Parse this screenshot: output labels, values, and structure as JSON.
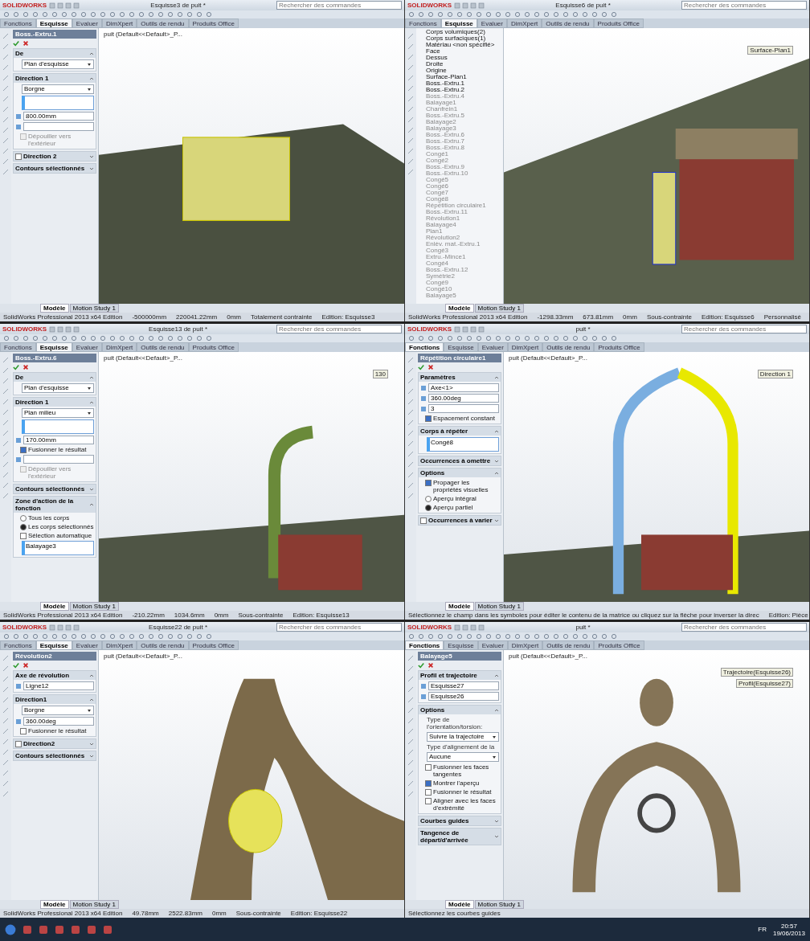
{
  "panels": [
    {
      "title": "Esquisse3 de puit *",
      "search": {
        "placeholder": "Rechercher des commandes"
      },
      "logo": "SOLIDWORKS",
      "tabs": [
        {
          "label": "Fonctions",
          "selected": false
        },
        {
          "label": "Esquisse",
          "selected": true
        },
        {
          "label": "Evaluer",
          "selected": false
        },
        {
          "label": "DimXpert",
          "selected": false
        },
        {
          "label": "Outils de rendu",
          "selected": false
        },
        {
          "label": "Produits Office",
          "selected": false
        }
      ],
      "left": {
        "kind": "property",
        "feature": "Boss.-Extru.1",
        "sections": [
          {
            "title": "De",
            "expanded": true,
            "items": [
              {
                "kind": "dropdown",
                "value": "Plan d'esquisse"
              }
            ]
          },
          {
            "title": "Direction 1",
            "expanded": true,
            "items": [
              {
                "kind": "dropdown",
                "value": "Borgne"
              },
              {
                "kind": "list"
              },
              {
                "kind": "field",
                "value": "800.00mm"
              },
              {
                "kind": "field"
              },
              {
                "kind": "checkbox",
                "label": "Dépouiller vers l'extérieur",
                "checked": false,
                "disabled": true
              }
            ]
          },
          {
            "title": "Direction 2",
            "expanded": false,
            "checked": false
          },
          {
            "title": "Contours sélectionnés",
            "expanded": false
          }
        ]
      },
      "viewport": {
        "kind": "extrude",
        "tree_path": "puit (Default<<Default>_P..."
      },
      "tabs_bottom": [
        {
          "label": "Modèle",
          "selected": true
        },
        {
          "label": "Motion Study 1",
          "selected": false
        }
      ],
      "status": [
        "SolidWorks Professional 2013 x64 Edition",
        "-500000mm",
        "220041.22mm",
        "0mm",
        "Totalement contrainte",
        "Edition: Esquisse3"
      ]
    },
    {
      "title": "Esquisse6 de puit *",
      "search": {
        "placeholder": "Rechercher des commandes"
      },
      "logo": "SOLIDWORKS",
      "tabs": [
        {
          "label": "Fonctions",
          "selected": false
        },
        {
          "label": "Esquisse",
          "selected": true
        },
        {
          "label": "Evaluer",
          "selected": false
        },
        {
          "label": "DimXpert",
          "selected": false
        },
        {
          "label": "Outils de rendu",
          "selected": false
        },
        {
          "label": "Produits Office",
          "selected": false
        }
      ],
      "left": {
        "kind": "tree",
        "items": [
          {
            "label": "Corps volumiques(2)",
            "disabled": false
          },
          {
            "label": "Corps surfaciques(1)",
            "disabled": false
          },
          {
            "label": "Matériau <non spécifié>",
            "disabled": false
          },
          {
            "label": "Face",
            "disabled": false
          },
          {
            "label": "Dessus",
            "disabled": false
          },
          {
            "label": "Droite",
            "disabled": false
          },
          {
            "label": "Origine",
            "disabled": false
          },
          {
            "label": "Surface-Plan1",
            "disabled": false
          },
          {
            "label": "Boss.-Extru.1",
            "disabled": false
          },
          {
            "label": "Boss.-Extru.2",
            "disabled": false
          },
          {
            "label": "Boss.-Extru.4",
            "disabled": true
          },
          {
            "label": "Balayage1",
            "disabled": true
          },
          {
            "label": "Chanfrein1",
            "disabled": true
          },
          {
            "label": "Boss.-Extru.5",
            "disabled": true
          },
          {
            "label": "Balayage2",
            "disabled": true
          },
          {
            "label": "Balayage3",
            "disabled": true
          },
          {
            "label": "Boss.-Extru.6",
            "disabled": true
          },
          {
            "label": "Boss.-Extru.7",
            "disabled": true
          },
          {
            "label": "Boss.-Extru.8",
            "disabled": true
          },
          {
            "label": "Congé1",
            "disabled": true
          },
          {
            "label": "Congé2",
            "disabled": true
          },
          {
            "label": "Boss.-Extru.9",
            "disabled": true
          },
          {
            "label": "Boss.-Extru.10",
            "disabled": true
          },
          {
            "label": "Congé5",
            "disabled": true
          },
          {
            "label": "Congé6",
            "disabled": true
          },
          {
            "label": "Congé7",
            "disabled": true
          },
          {
            "label": "Congé8",
            "disabled": true
          },
          {
            "label": "Répétition circulaire1",
            "disabled": true
          },
          {
            "label": "Boss.-Extru.11",
            "disabled": true
          },
          {
            "label": "Révolution1",
            "disabled": true
          },
          {
            "label": "Balayage4",
            "disabled": true
          },
          {
            "label": "Plan1",
            "disabled": true
          },
          {
            "label": "Révolution2",
            "disabled": true
          },
          {
            "label": "Enlèv. mat.-Extru.1",
            "disabled": true
          },
          {
            "label": "Congé3",
            "disabled": true
          },
          {
            "label": "Extru.-Mince1",
            "disabled": true
          },
          {
            "label": "Congé4",
            "disabled": true
          },
          {
            "label": "Boss.-Extru.12",
            "disabled": true
          },
          {
            "label": "Symétrie2",
            "disabled": true
          },
          {
            "label": "Congé9",
            "disabled": true
          },
          {
            "label": "Congé10",
            "disabled": true
          },
          {
            "label": "Balayage5",
            "disabled": true
          }
        ]
      },
      "viewport": {
        "kind": "well",
        "labels": [
          "Surface-Plan1"
        ]
      },
      "tabs_bottom": [
        {
          "label": "Modèle",
          "selected": true
        },
        {
          "label": "Motion Study 1",
          "selected": false
        }
      ],
      "status": [
        "SolidWorks Professional 2013 x64 Edition",
        "-1298.33mm",
        "673.81mm",
        "0mm",
        "Sous-contrainte",
        "Edition: Esquisse6",
        "Personnalisé"
      ]
    },
    {
      "title": "Esquisse13 de puit *",
      "search": {
        "placeholder": "Rechercher des commandes"
      },
      "logo": "SOLIDWORKS",
      "tabs": [
        {
          "label": "Fonctions",
          "selected": false
        },
        {
          "label": "Esquisse",
          "selected": true
        },
        {
          "label": "Evaluer",
          "selected": false
        },
        {
          "label": "DimXpert",
          "selected": false
        },
        {
          "label": "Outils de rendu",
          "selected": false
        },
        {
          "label": "Produits Office",
          "selected": false
        }
      ],
      "left": {
        "kind": "property",
        "feature": "Boss.-Extru.6",
        "sections": [
          {
            "title": "De",
            "expanded": true,
            "items": [
              {
                "kind": "dropdown",
                "value": "Plan d'esquisse"
              }
            ]
          },
          {
            "title": "Direction 1",
            "expanded": true,
            "items": [
              {
                "kind": "dropdown",
                "value": "Plan milieu"
              },
              {
                "kind": "list"
              },
              {
                "kind": "field",
                "value": "170.00mm"
              },
              {
                "kind": "checkbox",
                "label": "Fusionner le résultat",
                "checked": true,
                "disabled": false
              },
              {
                "kind": "field"
              },
              {
                "kind": "checkbox",
                "label": "Dépouiller vers l'extérieur",
                "checked": false,
                "disabled": true
              }
            ]
          },
          {
            "title": "Contours sélectionnés",
            "expanded": false
          },
          {
            "title": "Zone d'action de la fonction",
            "expanded": true,
            "items": [
              {
                "kind": "radio",
                "label": "Tous les corps",
                "selected": false
              },
              {
                "kind": "radio",
                "label": "Les corps sélectionnés",
                "selected": true
              },
              {
                "kind": "checkbox",
                "label": "Sélection automatique",
                "checked": false,
                "disabled": false
              },
              {
                "kind": "list",
                "value": "Balayage3"
              }
            ]
          }
        ]
      },
      "viewport": {
        "kind": "pipe",
        "tree_path": "puit (Default<<Default>_P...",
        "labels": [
          "130"
        ]
      },
      "tabs_bottom": [
        {
          "label": "Modèle",
          "selected": true
        },
        {
          "label": "Motion Study 1",
          "selected": false
        }
      ],
      "status": [
        "SolidWorks Professional 2013 x64 Edition",
        "-210.22mm",
        "1034.6mm",
        "0mm",
        "Sous-contrainte",
        "Edition: Esquisse13"
      ]
    },
    {
      "title": "puit *",
      "search": {
        "placeholder": "Rechercher des commandes"
      },
      "logo": "SOLIDWORKS",
      "tabs": [
        {
          "label": "Fonctions",
          "selected": true
        },
        {
          "label": "Esquisse",
          "selected": false
        },
        {
          "label": "Evaluer",
          "selected": false
        },
        {
          "label": "DimXpert",
          "selected": false
        },
        {
          "label": "Outils de rendu",
          "selected": false
        },
        {
          "label": "Produits Office",
          "selected": false
        }
      ],
      "left": {
        "kind": "property",
        "feature": "Répétition circulaire1",
        "sections": [
          {
            "title": "Paramètres",
            "expanded": true,
            "items": [
              {
                "kind": "field",
                "value": "Axe<1>"
              },
              {
                "kind": "field",
                "value": "360.00deg"
              },
              {
                "kind": "field",
                "value": "3"
              },
              {
                "kind": "checkbox",
                "label": "Espacement constant",
                "checked": true,
                "disabled": false
              }
            ]
          },
          {
            "title": "Corps à répéter",
            "expanded": true,
            "items": [
              {
                "kind": "list",
                "value": "Congé8"
              }
            ]
          },
          {
            "title": "Occurrences à omettre",
            "expanded": false
          },
          {
            "title": "Options",
            "expanded": true,
            "items": [
              {
                "kind": "checkbox",
                "label": "Propager les propriétés visuelles",
                "checked": true,
                "disabled": false
              },
              {
                "kind": "radio",
                "label": "Aperçu intégral",
                "selected": false
              },
              {
                "kind": "radio",
                "label": "Aperçu partiel",
                "selected": true
              }
            ]
          },
          {
            "title": "Occurrences à varier",
            "expanded": false,
            "checked": false
          }
        ]
      },
      "viewport": {
        "kind": "arches",
        "tree_path": "puit (Default<<Default>_P...",
        "labels": [
          "Direction 1"
        ]
      },
      "tabs_bottom": [
        {
          "label": "Modèle",
          "selected": true
        },
        {
          "label": "Motion Study 1",
          "selected": false
        }
      ],
      "status": [
        "Sélectionnez le champ dans les symboles pour éditer le contenu de la matrice ou cliquez sur la flèche pour inverser la direc",
        "Edition: Pièce"
      ]
    },
    {
      "title": "Esquisse22 de puit *",
      "search": {
        "placeholder": "Rechercher des commandes"
      },
      "logo": "SOLIDWORKS",
      "tabs": [
        {
          "label": "Fonctions",
          "selected": false
        },
        {
          "label": "Esquisse",
          "selected": true
        },
        {
          "label": "Evaluer",
          "selected": false
        },
        {
          "label": "DimXpert",
          "selected": false
        },
        {
          "label": "Outils de rendu",
          "selected": false
        },
        {
          "label": "Produits Office",
          "selected": false
        }
      ],
      "left": {
        "kind": "property",
        "feature": "Révolution2",
        "sections": [
          {
            "title": "Axe de révolution",
            "expanded": true,
            "items": [
              {
                "kind": "field",
                "value": "Ligne12"
              }
            ]
          },
          {
            "title": "Direction1",
            "expanded": true,
            "items": [
              {
                "kind": "dropdown",
                "value": "Borgne"
              },
              {
                "kind": "field",
                "value": "360.00deg"
              },
              {
                "kind": "checkbox",
                "label": "Fusionner le résultat",
                "checked": false,
                "disabled": false
              }
            ]
          },
          {
            "title": "Direction2",
            "expanded": false,
            "checked": false
          },
          {
            "title": "Contours sélectionnés",
            "expanded": false
          }
        ]
      },
      "viewport": {
        "kind": "closeup",
        "tree_path": "puit (Default<<Default>_P..."
      },
      "tabs_bottom": [
        {
          "label": "Modèle",
          "selected": true
        },
        {
          "label": "Motion Study 1",
          "selected": false
        }
      ],
      "status": [
        "SolidWorks Professional 2013 x64 Edition",
        "49.78mm",
        "2522.83mm",
        "0mm",
        "Sous-contrainte",
        "Edition: Esquisse22"
      ]
    },
    {
      "title": "puit *",
      "search": {
        "placeholder": "Rechercher des commandes"
      },
      "logo": "SOLIDWORKS",
      "tabs": [
        {
          "label": "Fonctions",
          "selected": true
        },
        {
          "label": "Esquisse",
          "selected": false
        },
        {
          "label": "Evaluer",
          "selected": false
        },
        {
          "label": "DimXpert",
          "selected": false
        },
        {
          "label": "Outils de rendu",
          "selected": false
        },
        {
          "label": "Produits Office",
          "selected": false
        }
      ],
      "left": {
        "kind": "property",
        "feature": "Balayage5",
        "sections": [
          {
            "title": "Profil et trajectoire",
            "expanded": true,
            "items": [
              {
                "kind": "field",
                "value": "Esquisse27"
              },
              {
                "kind": "field",
                "value": "Esquisse26"
              }
            ]
          },
          {
            "title": "Options",
            "expanded": true,
            "items": [
              {
                "kind": "caption",
                "value": "Type de l'orientation/torsion:"
              },
              {
                "kind": "dropdown",
                "value": "Suivre la trajectoire"
              },
              {
                "kind": "caption",
                "value": "Type d'alignement de la"
              },
              {
                "kind": "dropdown",
                "value": "Aucune"
              },
              {
                "kind": "checkbox",
                "label": "Fusionner les faces tangentes",
                "checked": false,
                "disabled": false
              },
              {
                "kind": "checkbox",
                "label": "Montrer l'aperçu",
                "checked": true,
                "disabled": false
              },
              {
                "kind": "checkbox",
                "label": "Fusionner le résultat",
                "checked": false,
                "disabled": false
              },
              {
                "kind": "checkbox",
                "label": "Aligner avec les faces d'extrémité",
                "checked": false,
                "disabled": false
              }
            ]
          },
          {
            "title": "Courbes guides",
            "expanded": false
          },
          {
            "title": "Tangence de départ/d'arrivée",
            "expanded": false
          }
        ]
      },
      "viewport": {
        "kind": "top",
        "tree_path": "puit (Default<<Default>_P...",
        "labels": [
          "Trajectoire(Esquisse26)",
          "Profil(Esquisse27)"
        ]
      },
      "tabs_bottom": [
        {
          "label": "Modèle",
          "selected": true
        },
        {
          "label": "Motion Study 1",
          "selected": false
        }
      ],
      "status": [
        "Sélectionnez les courbes guides"
      ]
    }
  ],
  "taskbar": {
    "language": "FR",
    "time": "20:57",
    "date": "19/06/2013"
  }
}
